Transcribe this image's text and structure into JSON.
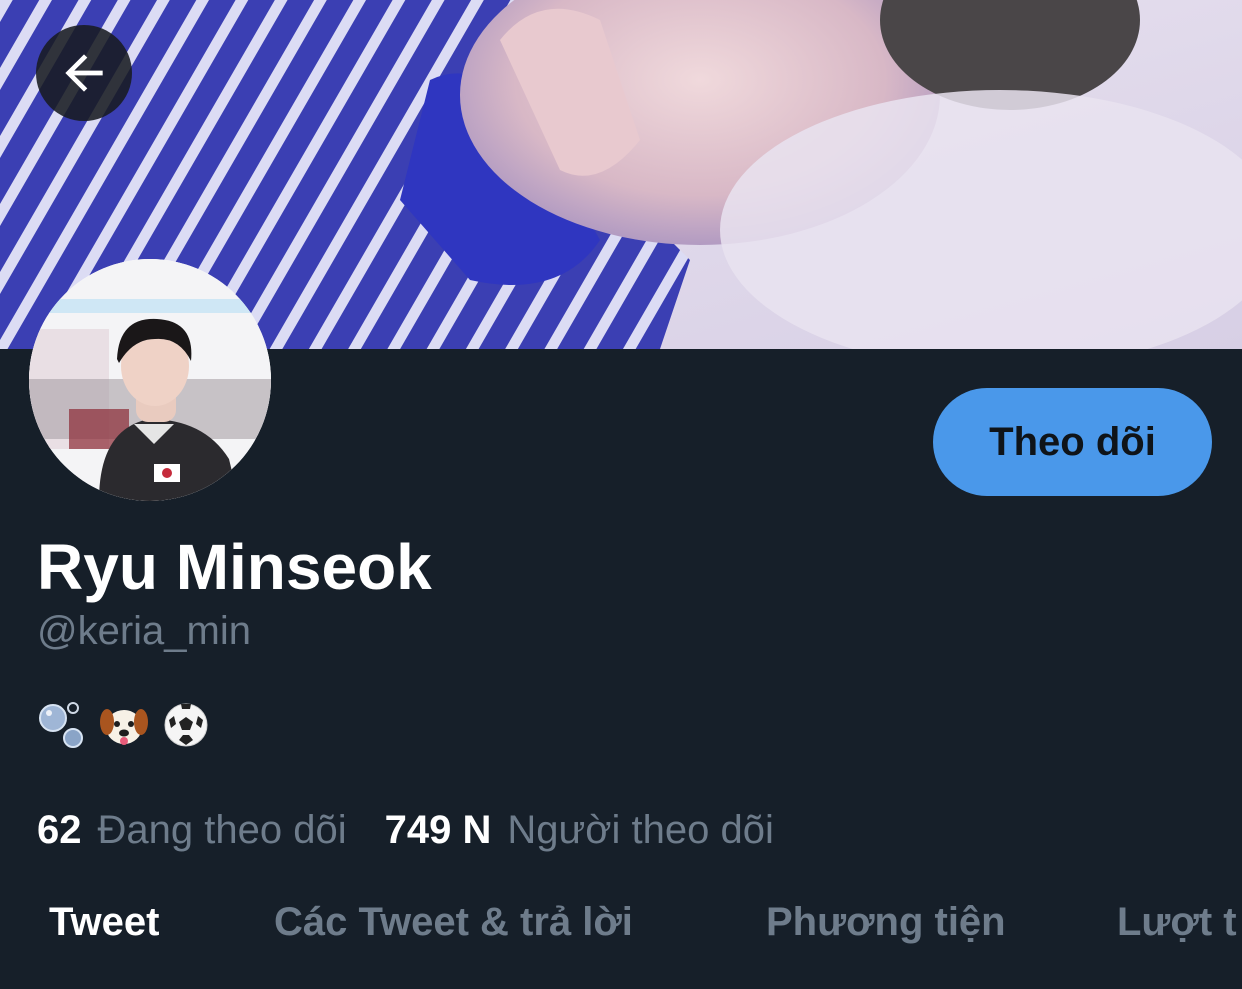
{
  "header": {
    "back_icon": "arrow-left-icon",
    "banner": "banner-photo"
  },
  "profile": {
    "avatar": "avatar-photo",
    "display_name": "Ryu Minseok",
    "handle": "@keria_min",
    "bio_emojis": [
      "bubbles-emoji",
      "dog-face-emoji",
      "soccer-ball-emoji"
    ],
    "follow_label": "Theo dõi"
  },
  "stats": {
    "following_count": "62",
    "following_label": "Đang theo dõi",
    "followers_count": "749 N",
    "followers_label": "Người theo dõi"
  },
  "tabs": [
    {
      "label": "Tweet",
      "active": true
    },
    {
      "label": "Các Tweet & trả lời",
      "active": false
    },
    {
      "label": "Phương tiện",
      "active": false
    },
    {
      "label": "Lượt t",
      "active": false
    }
  ],
  "colors": {
    "background": "#161f29",
    "accent": "#4a98ea",
    "secondary_text": "#6e7c8b",
    "primary_text": "#ffffff"
  }
}
